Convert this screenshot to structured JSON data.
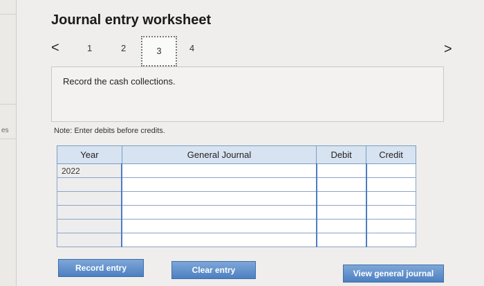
{
  "page": {
    "left_stub": "es",
    "title": "Journal entry worksheet"
  },
  "navigation": {
    "prev_icon": "chevron-left-icon",
    "next_icon": "chevron-right-icon",
    "prev_glyph": "<",
    "next_glyph": ">",
    "steps": [
      "1",
      "2",
      "3",
      "4"
    ],
    "active_step": "3"
  },
  "instruction": {
    "text": "Record the cash collections."
  },
  "note": "Note: Enter debits before credits.",
  "journal_table": {
    "headers": {
      "year": "Year",
      "general_journal": "General Journal",
      "debit": "Debit",
      "credit": "Credit"
    },
    "rows": [
      {
        "year": "2022",
        "account": "",
        "debit": "",
        "credit": ""
      },
      {
        "year": "",
        "account": "",
        "debit": "",
        "credit": ""
      },
      {
        "year": "",
        "account": "",
        "debit": "",
        "credit": ""
      },
      {
        "year": "",
        "account": "",
        "debit": "",
        "credit": ""
      },
      {
        "year": "",
        "account": "",
        "debit": "",
        "credit": ""
      },
      {
        "year": "",
        "account": "",
        "debit": "",
        "credit": ""
      }
    ]
  },
  "buttons": {
    "record_entry": "Record entry",
    "clear_entry": "Clear entry",
    "view_general_journal": "View general journal"
  },
  "colors": {
    "button_blue": "#4d7fc1",
    "header_blue": "#d7e3f1",
    "entry_border_blue": "#4b7cc4"
  }
}
